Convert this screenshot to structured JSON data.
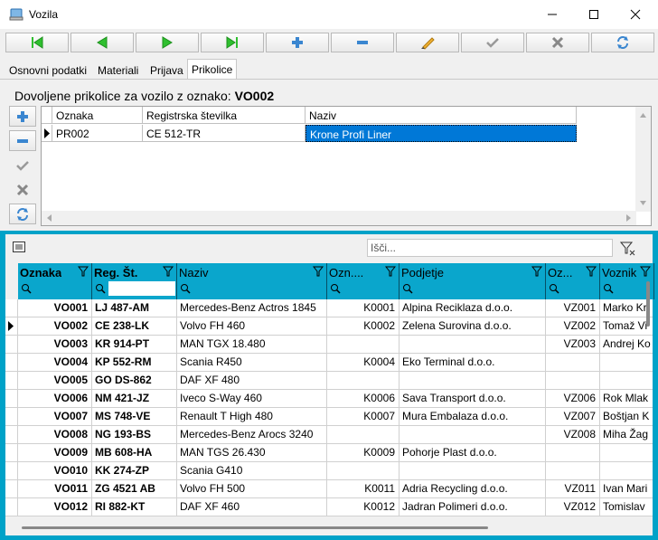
{
  "window": {
    "title": "Vozila"
  },
  "tabs": [
    "Osnovni podatki",
    "Materiali",
    "Prijava",
    "Prikolice"
  ],
  "trailers": {
    "label_prefix": "Dovoljene prikolice za vozilo z oznako:",
    "vehicle_code": "VO002",
    "columns": [
      "Oznaka",
      "Registrska številka",
      "Naziv"
    ],
    "rows": [
      {
        "code": "PR002",
        "reg": "CE 512-TR",
        "name": "Krone Profi Liner"
      }
    ]
  },
  "vehicles": {
    "search_placeholder": "Išči...",
    "columns": [
      "Oznaka",
      "Reg. Št.",
      "Naziv",
      "Ozn....",
      "Podjetje",
      "Oz...",
      "Voznik"
    ],
    "rows": [
      {
        "oznaka": "VO001",
        "reg": "LJ 487-AM",
        "naziv": "Mercedes-Benz Actros 1845",
        "ozn": "K0001",
        "podjetje": "Alpina Reciklaza d.o.o.",
        "oz": "VZ001",
        "voznik": "Marko Kr"
      },
      {
        "oznaka": "VO002",
        "reg": "CE 238-LK",
        "naziv": "Volvo FH 460",
        "ozn": "K0002",
        "podjetje": "Zelena Surovina d.o.o.",
        "oz": "VZ002",
        "voznik": "Tomaž Vi"
      },
      {
        "oznaka": "VO003",
        "reg": "KR 914-PT",
        "naziv": "MAN TGX 18.480",
        "ozn": "",
        "podjetje": "",
        "oz": "VZ003",
        "voznik": "Andrej Ko"
      },
      {
        "oznaka": "VO004",
        "reg": "KP 552-RM",
        "naziv": "Scania R450",
        "ozn": "K0004",
        "podjetje": "Eko Terminal d.o.o.",
        "oz": "",
        "voznik": ""
      },
      {
        "oznaka": "VO005",
        "reg": "GO DS-862",
        "naziv": "DAF XF 480",
        "ozn": "",
        "podjetje": "",
        "oz": "",
        "voznik": ""
      },
      {
        "oznaka": "VO006",
        "reg": "NM 421-JZ",
        "naziv": "Iveco S-Way 460",
        "ozn": "K0006",
        "podjetje": "Sava Transport d.o.o.",
        "oz": "VZ006",
        "voznik": "Rok Mlak"
      },
      {
        "oznaka": "VO007",
        "reg": "MS 748-VE",
        "naziv": "Renault T High 480",
        "ozn": "K0007",
        "podjetje": "Mura Embalaza d.o.o.",
        "oz": "VZ007",
        "voznik": "Boštjan K"
      },
      {
        "oznaka": "VO008",
        "reg": "NG 193-BS",
        "naziv": "Mercedes-Benz Arocs 3240",
        "ozn": "",
        "podjetje": "",
        "oz": "VZ008",
        "voznik": "Miha Žag"
      },
      {
        "oznaka": "VO009",
        "reg": "MB 608-HA",
        "naziv": "MAN TGS 26.430",
        "ozn": "K0009",
        "podjetje": "Pohorje Plast d.o.o.",
        "oz": "",
        "voznik": ""
      },
      {
        "oznaka": "VO010",
        "reg": "KK 274-ZP",
        "naziv": "Scania G410",
        "ozn": "",
        "podjetje": "",
        "oz": "",
        "voznik": ""
      },
      {
        "oznaka": "VO011",
        "reg": "ZG 4521 AB",
        "naziv": "Volvo FH 500",
        "ozn": "K0011",
        "podjetje": "Adria Recycling d.o.o.",
        "oz": "VZ011",
        "voznik": "Ivan Mari"
      },
      {
        "oznaka": "VO012",
        "reg": "RI 882-KT",
        "naziv": "DAF XF 460",
        "ozn": "K0012",
        "podjetje": "Jadran Polimeri d.o.o.",
        "oz": "VZ012",
        "voznik": "Tomislav"
      }
    ]
  },
  "colors": {
    "accent": "#00a2c8",
    "header": "#0aa6cc",
    "selection": "#0078d7",
    "green": "#2fbf2f"
  },
  "icons": [
    "app-icon",
    "first-record-icon",
    "previous-record-icon",
    "next-record-icon",
    "last-record-icon",
    "add-icon",
    "remove-icon",
    "edit-pencil-icon",
    "confirm-check-icon",
    "cancel-x-icon",
    "refresh-icon",
    "filter-icon",
    "search-icon",
    "column-chooser-icon"
  ]
}
